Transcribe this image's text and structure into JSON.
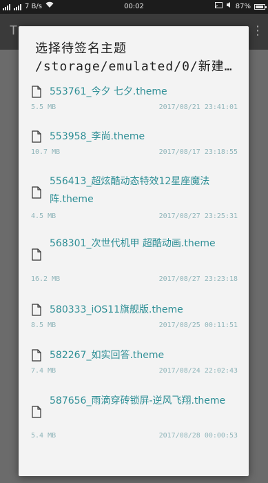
{
  "status_bar": {
    "carrier_indicators": "7 B/s",
    "time": "00:02",
    "battery_percent": "87%"
  },
  "background_app": {
    "title": "T",
    "menu": "⋮"
  },
  "dialog": {
    "title": "选择待签名主题",
    "path": "/storage/emulated/0/新建文…",
    "files": [
      {
        "name": "553761_今夕 七夕.theme",
        "size": "5.5 MB",
        "date": "2017/08/21 23:41:01"
      },
      {
        "name": "553958_李尚.theme",
        "size": "10.7 MB",
        "date": "2017/08/17 23:18:55"
      },
      {
        "name": "556413_超炫酷动态特效12星座魔法阵.theme",
        "size": "4.5 MB",
        "date": "2017/08/27 23:25:31"
      },
      {
        "name": "568301_次世代机甲 超酷动画.theme",
        "size": "16.2 MB",
        "date": "2017/08/27 23:23:18"
      },
      {
        "name": "580333_iOS11旗舰版.theme",
        "size": "8.5 MB",
        "date": "2017/08/25 00:11:51"
      },
      {
        "name": "582267_如实回答.theme",
        "size": "7.4 MB",
        "date": "2017/08/24 22:02:43"
      },
      {
        "name": "587656_雨滴穿砖锁屏-逆风飞翔.theme",
        "size": "5.4 MB",
        "date": "2017/08/28 00:00:53"
      }
    ]
  }
}
